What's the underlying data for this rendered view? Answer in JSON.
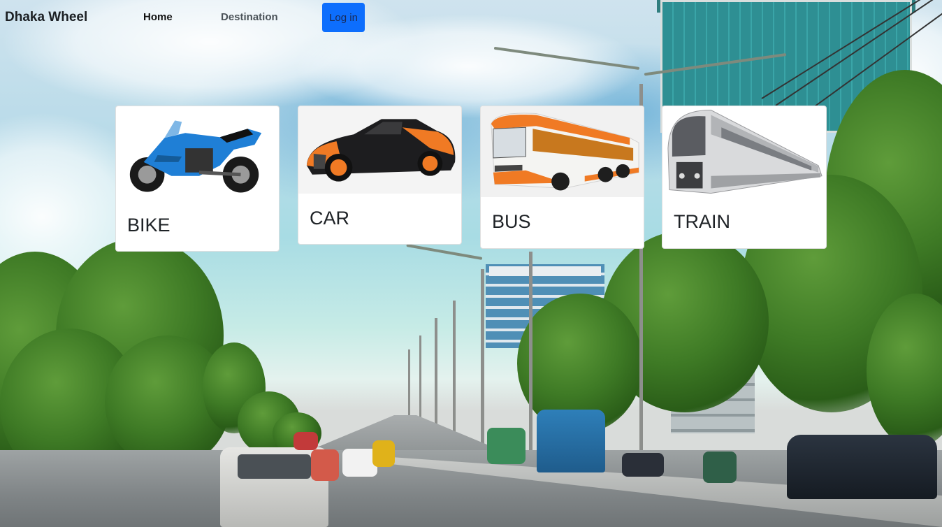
{
  "navbar": {
    "brand": "Dhaka Wheel",
    "home_label": "Home",
    "destination_label": "Destination",
    "login_label": "Log in"
  },
  "vehicles": [
    {
      "title": "BIKE",
      "icon": "motorcycle-icon"
    },
    {
      "title": "CAR",
      "icon": "sports-car-icon"
    },
    {
      "title": "BUS",
      "icon": "bus-icon"
    },
    {
      "title": "TRAIN",
      "icon": "train-icon"
    }
  ],
  "colors": {
    "primary_button": "#0d6efd",
    "bike": "#1f7fd6",
    "car_accent": "#f07a24",
    "bus_accent": "#f0762a"
  }
}
